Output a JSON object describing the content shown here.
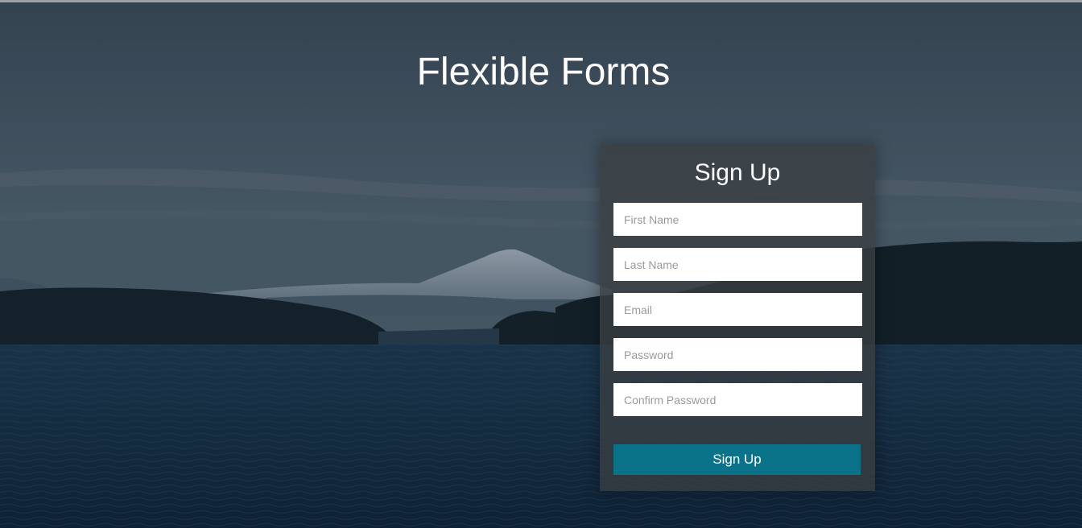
{
  "page": {
    "title": "Flexible Forms"
  },
  "form": {
    "title": "Sign Up",
    "fields": [
      {
        "placeholder": "First Name",
        "value": ""
      },
      {
        "placeholder": "Last Name",
        "value": ""
      },
      {
        "placeholder": "Email",
        "value": ""
      },
      {
        "placeholder": "Password",
        "value": ""
      },
      {
        "placeholder": "Confirm Password",
        "value": ""
      }
    ],
    "submit_label": "Sign Up"
  },
  "colors": {
    "button": "#0a7389",
    "panel": "#3a3e42",
    "title_text": "#ffffff"
  }
}
